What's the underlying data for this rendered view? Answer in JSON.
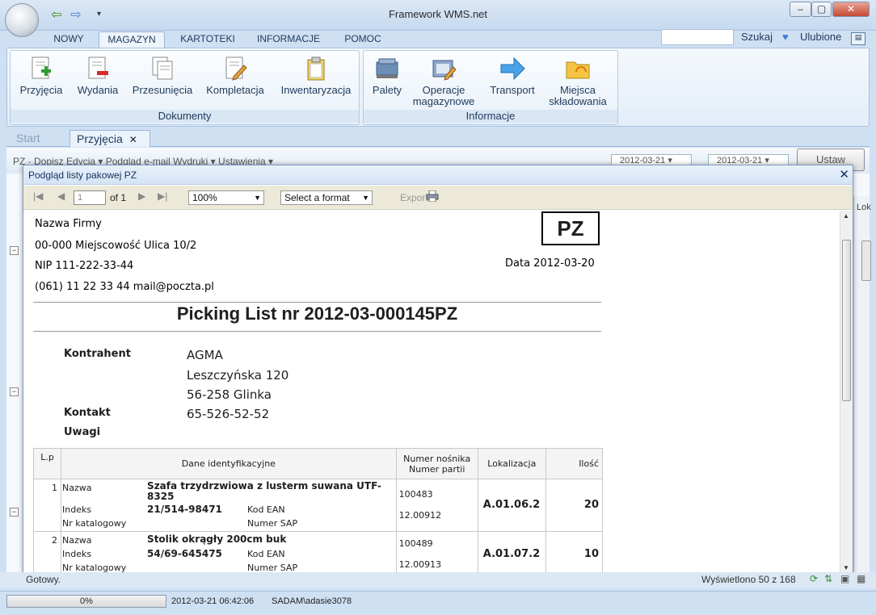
{
  "window": {
    "title": "Framework WMS.net",
    "minimize": "–",
    "maximize": "▢",
    "close": "✕"
  },
  "quick_access": {
    "back_icon": "arrow-left-icon",
    "forward_icon": "arrow-right-icon",
    "more": "▾"
  },
  "ribbon_tabs": [
    "NOWY",
    "MAGAZYN",
    "KARTOTEKI",
    "INFORMACJE",
    "POMOC"
  ],
  "ribbon_active_tab": "MAGAZYN",
  "top_right": {
    "search_label": "Szukaj",
    "favorites_label": "Ulubione"
  },
  "ribbon": {
    "groups": [
      {
        "label": "Dokumenty",
        "buttons": [
          "Przyjęcia",
          "Wydania",
          "Przesunięcia",
          "Kompletacja",
          "Inwentaryzacja"
        ]
      },
      {
        "label": "Informacje",
        "buttons": [
          "Palety",
          "Operacje magazynowe",
          "Transport",
          "Miejsca składowania"
        ]
      }
    ]
  },
  "doc_tabs": [
    {
      "label": "Start",
      "active": false
    },
    {
      "label": "Przyjęcia",
      "active": true
    }
  ],
  "background": {
    "toolbar": "PZ · Dopisz  Edycja ▾  Podgląd  e-mail  Wydruki ▾  Ustawienia ▾",
    "date_from": "2012-03-21 ▾",
    "date_to": "2012-03-21 ▾",
    "button": "Ustaw",
    "col_lok": "Lok"
  },
  "dialog": {
    "title": "Podgląd listy pakowej PZ",
    "page_value": "1",
    "of_label": "of 1",
    "zoom": "100%",
    "format": "Select a format",
    "export": "Export"
  },
  "report": {
    "company": [
      "Nazwa Firmy",
      "00-000 Miejscowość Ulica 10/2",
      "NIP 111-222-33-44",
      "(061) 11 22 33 44 mail@poczta.pl"
    ],
    "doc_type": "PZ",
    "date": "Data 2012-03-20",
    "title": "Picking List nr 2012-03-000145PZ",
    "kontrahent_label": "Kontrahent",
    "kontrahent": [
      "AGMA",
      "Leszczyńska 120",
      "56-258 Glinka"
    ],
    "kontakt_label": "Kontakt",
    "kontakt": "65-526-52-52",
    "uwagi_label": "Uwagi",
    "table_headers": {
      "lp": "L.p",
      "dane": "Dane identyfikacyjne",
      "nosnik": "Numer nośnika",
      "partia": "Numer partii",
      "lokalizacja": "Lokalizacja",
      "ilosc": "Ilość"
    },
    "field_labels": {
      "nazwa": "Nazwa",
      "indeks": "Indeks",
      "nr_kat": "Nr katalogowy",
      "ean": "Kod EAN",
      "sap": "Numer SAP"
    },
    "items": [
      {
        "lp": "1",
        "nazwa": "Szafa trzydrzwiowa z lusterm suwana UTF-8325",
        "indeks": "21/514-98471",
        "nosnik": "100483",
        "partia": "12.00912",
        "lokalizacja": "A.01.06.2",
        "ilosc": "20"
      },
      {
        "lp": "2",
        "nazwa": "Stolik okrągły 200cm buk",
        "indeks": "54/69-645475",
        "nosnik": "100489",
        "partia": "12.00913",
        "lokalizacja": "A.01.07.2",
        "ilosc": "10"
      }
    ]
  },
  "status": {
    "ready": "Gotowy.",
    "shown": "Wyświetlono 50 z 168",
    "progress": "0%",
    "datetime": "2012-03-21 06:42:06",
    "user": "SADAM\\adasie3078"
  }
}
